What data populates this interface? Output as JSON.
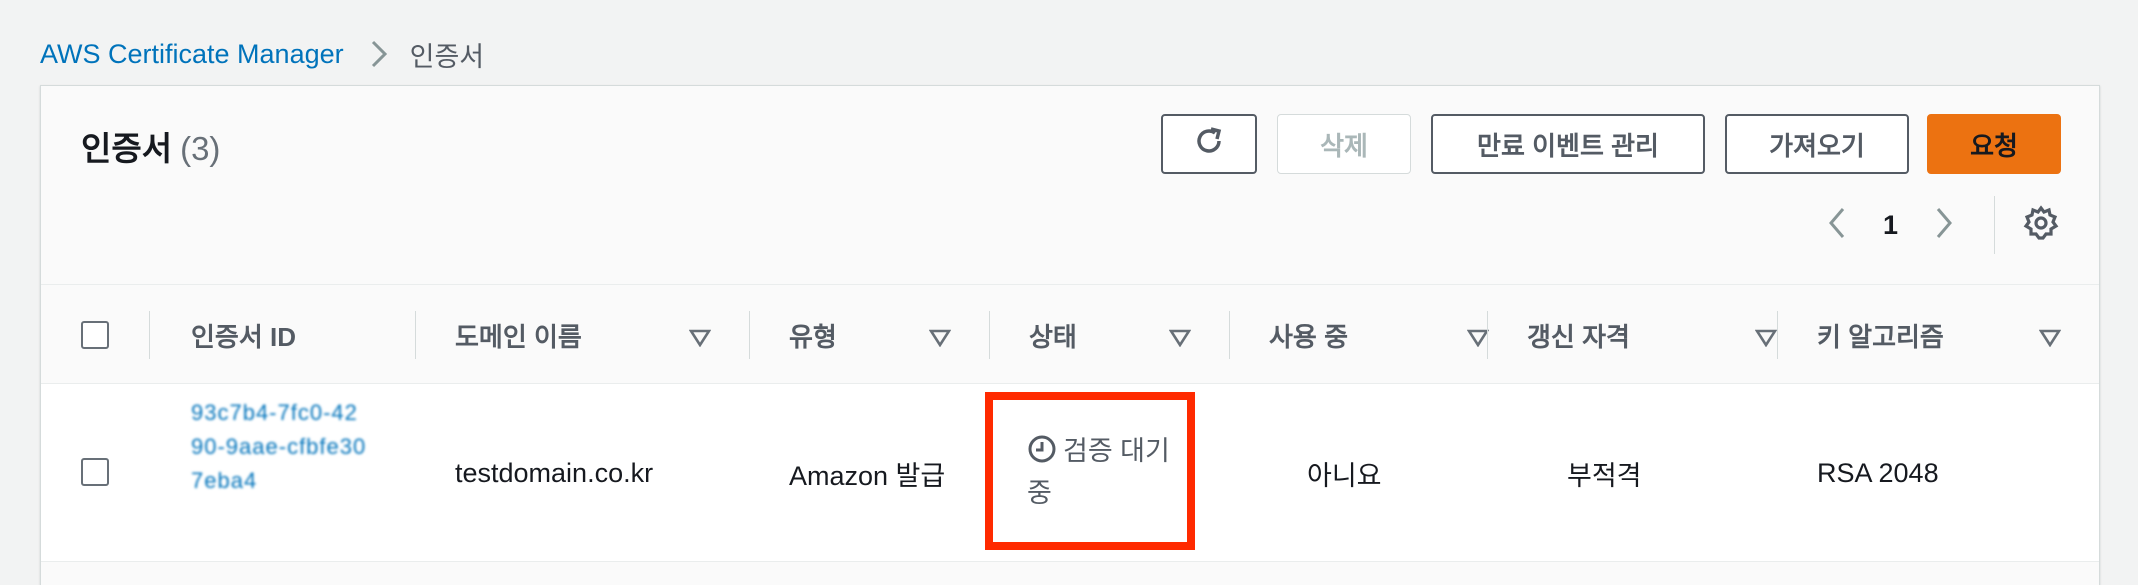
{
  "breadcrumb": {
    "root": "AWS Certificate Manager",
    "current": "인증서"
  },
  "header": {
    "title": "인증서",
    "count": "(3)"
  },
  "actions": {
    "delete": "삭제",
    "expiry_events": "만료 이벤트 관리",
    "import": "가져오기",
    "request": "요청"
  },
  "pagination": {
    "page": "1"
  },
  "table": {
    "columns": [
      "인증서 ID",
      "도메인 이름",
      "유형",
      "상태",
      "사용 중",
      "갱신 자격",
      "키 알고리즘"
    ],
    "rows": [
      {
        "id": "93c7b4-7fc0-4290-9aae-cfbfe307eba4",
        "domain": "testdomain.co.kr",
        "type": "Amazon 발급",
        "status": "검증 대기 중",
        "in_use": "아니요",
        "renewal": "부적격",
        "key_algorithm": "RSA 2048"
      }
    ]
  },
  "colors": {
    "link": "#0073bb",
    "primary": "#ec7211",
    "highlight": "#ff2a00"
  },
  "icons": [
    "chevron-right-icon",
    "refresh-icon",
    "chevron-left-icon",
    "settings-gear-icon",
    "sort-caret-icon",
    "clock-icon"
  ]
}
